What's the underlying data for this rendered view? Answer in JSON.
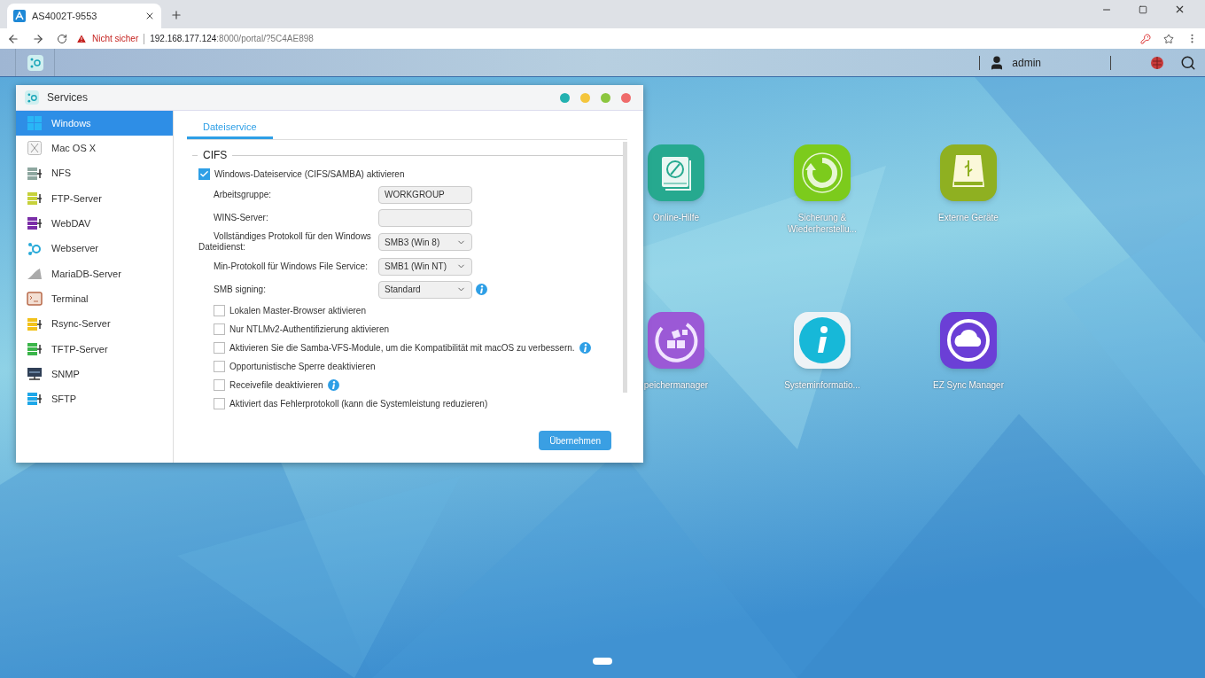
{
  "browser": {
    "tab_title": "AS4002T-9553",
    "warning": "Nicht sicher",
    "url_host": "192.168.177.124",
    "url_rest": ":8000/portal/?5C4AE898"
  },
  "nas_bar": {
    "user": "admin"
  },
  "window": {
    "title": "Services",
    "sidebar": [
      {
        "label": "Windows",
        "selected": true
      },
      {
        "label": "Mac OS X",
        "selected": false
      },
      {
        "label": "NFS",
        "selected": false
      },
      {
        "label": "FTP-Server",
        "selected": false
      },
      {
        "label": "WebDAV",
        "selected": false
      },
      {
        "label": "Webserver",
        "selected": false
      },
      {
        "label": "MariaDB-Server",
        "selected": false
      },
      {
        "label": "Terminal",
        "selected": false
      },
      {
        "label": "Rsync-Server",
        "selected": false
      },
      {
        "label": "TFTP-Server",
        "selected": false
      },
      {
        "label": "SNMP",
        "selected": false
      },
      {
        "label": "SFTP",
        "selected": false
      }
    ],
    "tabs": [
      {
        "label": "Dateiservice",
        "selected": true
      }
    ],
    "section": "CIFS",
    "main_checkbox": {
      "label": "Windows-Dateiservice (CIFS/SAMBA) aktivieren",
      "checked": true
    },
    "fields": [
      {
        "kind": "text",
        "label": "Arbeitsgruppe:",
        "value": "WORKGROUP",
        "info": false
      },
      {
        "kind": "text",
        "label": "WINS-Server:",
        "info": false
      },
      {
        "kind": "select",
        "label": "Vollständiges Protokoll für den Windows Dateidienst:",
        "value": "SMB3 (Win 8)",
        "info": false
      },
      {
        "kind": "select",
        "label": "Min-Protokoll für Windows File Service:",
        "value": "SMB1 (Win NT)",
        "info": false
      },
      {
        "kind": "select",
        "label": "SMB signing:",
        "value": "Standard",
        "info": true
      }
    ],
    "options": [
      {
        "label": "Lokalen Master-Browser aktivieren",
        "checked": false,
        "info": false
      },
      {
        "label": "Nur NTLMv2-Authentifizierung aktivieren",
        "checked": false,
        "info": false
      },
      {
        "label": "Aktivieren Sie die Samba-VFS-Module, um die Kompatibilität mit macOS zu verbessern.",
        "checked": false,
        "info": true
      },
      {
        "label": "Opportunistische Sperre deaktivieren",
        "checked": false,
        "info": false
      },
      {
        "label": "Receivefile deaktivieren",
        "checked": false,
        "info": true
      },
      {
        "label": "Aktiviert das Fehlerprotokoll (kann die Systemleistung reduzieren)",
        "checked": false,
        "info": false
      }
    ],
    "apply_button": "Übernehmen"
  },
  "desktop_apps": [
    {
      "label": "Online-Hilfe"
    },
    {
      "label": "Sicherung & Wiederherstellu..."
    },
    {
      "label": "Externe Geräte"
    },
    {
      "label": "peichermanager"
    },
    {
      "label": "Systeminformatio..."
    },
    {
      "label": "EZ Sync Manager"
    }
  ]
}
